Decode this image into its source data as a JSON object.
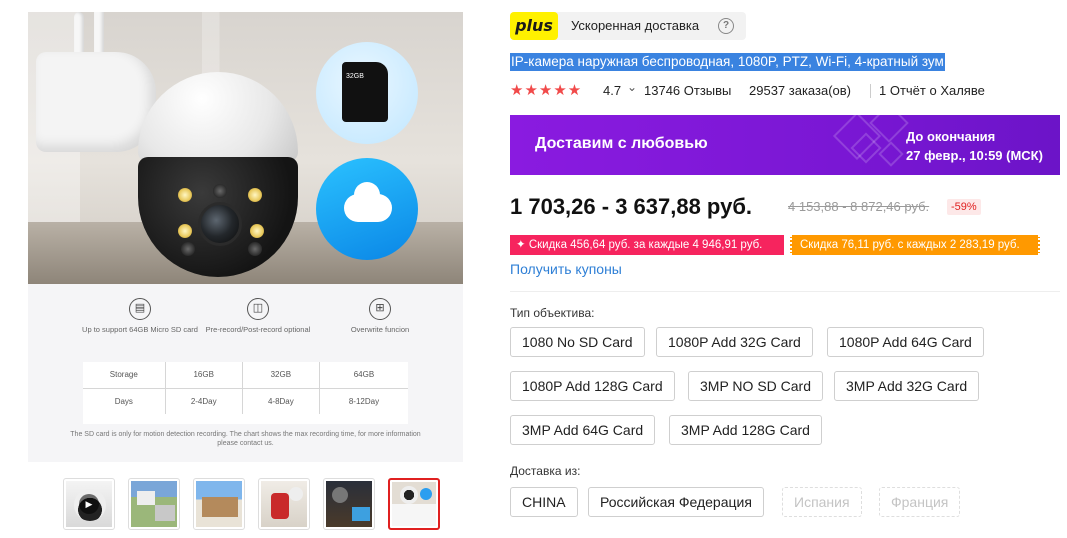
{
  "gallery": {
    "sd_card_text": "32GB",
    "features": [
      {
        "icon": "sd-card-icon",
        "label": "Up to support 64GB Micro SD card"
      },
      {
        "icon": "camera-record-icon",
        "label": "Pre-record/Post-record optional"
      },
      {
        "icon": "overwrite-icon",
        "label": "Overwrite funcion"
      }
    ],
    "storage_table": {
      "header": [
        "Storage",
        "16GB",
        "32GB",
        "64GB"
      ],
      "row": [
        "Days",
        "2-4Day",
        "4-8Day",
        "8-12Day"
      ]
    },
    "storage_note": "The SD card is only for motion detection recording. The chart shows the max recording time, for more information please contact us.",
    "thumbnail_count": 6,
    "active_thumbnail_index": 5
  },
  "delivery_badge": {
    "logo": "plus",
    "text": "Ускоренная доставка",
    "help": "?"
  },
  "product": {
    "title": "IP-камера наружная беспроводная, 1080P, PTZ, Wi-Fi, 4-кратный зум",
    "stars": "★★★★★",
    "rating": "4.7",
    "rating_caret": "⌄",
    "reviews": "13746 Отзывы",
    "orders": "29537 заказа(ов)",
    "reports": "1 Отчёт о Халяве"
  },
  "promo": {
    "left_text": "Доставим с любовью",
    "until_label": "До окончания",
    "until_date": "27 февр., 10:59 (МСК)",
    "bg_color": "#7a17d4"
  },
  "pricing": {
    "price": "1 703,26 - 3 637,88 руб.",
    "old_price": "4 153,88 - 8 872,46 руб.",
    "discount": "-59%",
    "coupon_1": "✦ Скидка 456,64 руб. за каждые 4 946,91 руб.",
    "coupon_2": "Скидка 76,11 руб. с каждых 2 283,19 руб.",
    "get_coupons": "Получить купоны"
  },
  "lens": {
    "label": "Тип объектива:",
    "options": [
      "1080 No SD Card",
      "1080P Add 32G Card",
      "1080P Add 64G Card",
      "1080P Add 128G Card",
      "3MP NO SD Card",
      "3MP Add 32G Card",
      "3MP Add 64G Card",
      "3MP Add 128G Card"
    ]
  },
  "ship_from": {
    "label": "Доставка из:",
    "options": [
      {
        "label": "CHINA",
        "available": true
      },
      {
        "label": "Российская Федерация",
        "available": true
      },
      {
        "label": "Испания",
        "available": false
      },
      {
        "label": "Франция",
        "available": false
      }
    ]
  }
}
